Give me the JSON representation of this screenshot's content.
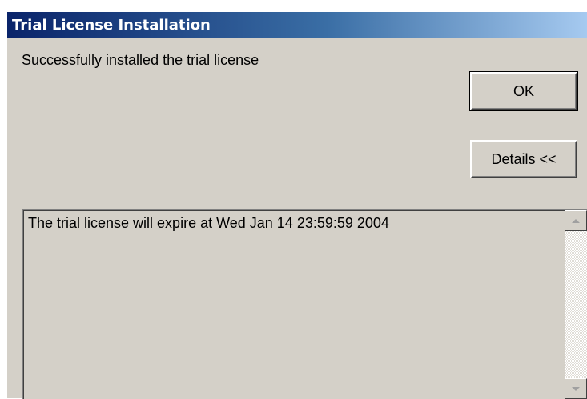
{
  "window": {
    "title": "Trial License Installation"
  },
  "dialog": {
    "message": "Successfully installed the trial license",
    "ok_label": "OK",
    "details_label": "Details <<"
  },
  "details": {
    "text": "The trial license will expire at Wed Jan 14 23:59:59 2004"
  },
  "icons": {
    "scroll_up": "scroll-up-arrow-icon",
    "scroll_down": "scroll-down-arrow-icon"
  },
  "colors": {
    "title_bar_start": "#0a246a",
    "title_bar_end": "#a6caf0",
    "dialog_face": "#d4d0c8"
  }
}
